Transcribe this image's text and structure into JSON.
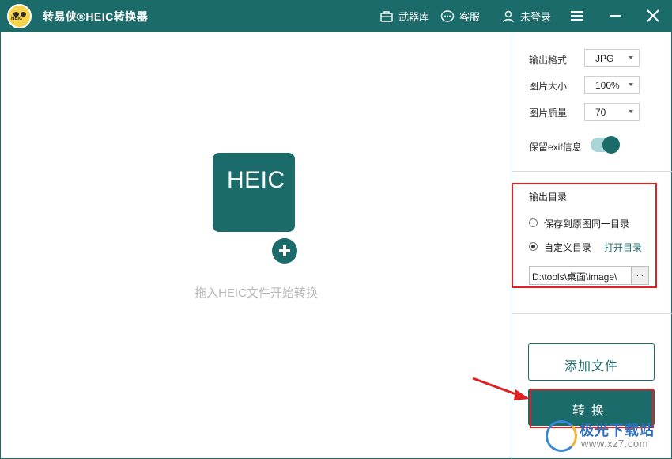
{
  "app": {
    "title": "转易侠®HEIC转换器",
    "logo_text": "HEIC"
  },
  "titlebar": {
    "arsenal_label": "武器库",
    "service_label": "客服",
    "login_label": "未登录"
  },
  "drop_area": {
    "tile_label": "HEIC",
    "hint": "拖入HEIC文件开始转换"
  },
  "settings": {
    "format_label": "输出格式:",
    "format_value": "JPG",
    "size_label": "图片大小:",
    "size_value": "100%",
    "quality_label": "图片质量:",
    "quality_value": "70",
    "exif_label": "保留exif信息",
    "exif_enabled": true
  },
  "output": {
    "title": "输出目录",
    "option_same": "保存到原图同一目录",
    "option_custom": "自定义目录",
    "selected": "custom",
    "open_link": "打开目录",
    "path": "D:\\tools\\桌面\\image\\",
    "browse_label": "..."
  },
  "actions": {
    "add_files": "添加文件",
    "convert": "转换"
  },
  "watermark": {
    "text": "极光下载站",
    "url": "www.xz7.com"
  },
  "colors": {
    "primary": "#1b6b6b",
    "highlight": "#e02020",
    "hint": "#b8b8b8"
  }
}
